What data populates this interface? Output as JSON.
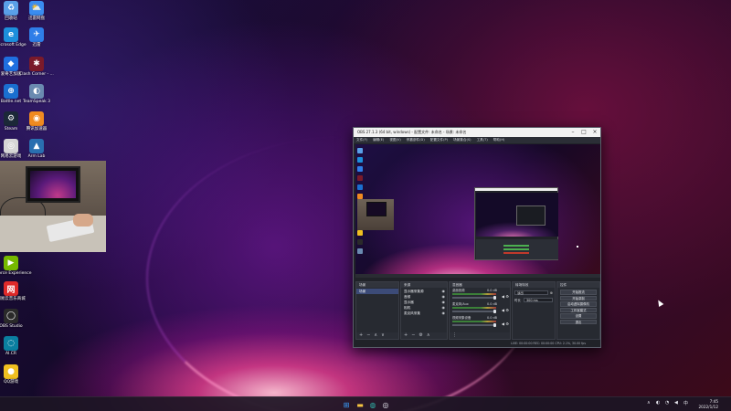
{
  "desktop": {
    "icons": [
      {
        "label": "回收站",
        "color": "#5aa0e8",
        "glyph": "♻",
        "name": "recycle-bin-icon"
      },
      {
        "label": "迅雷网盘",
        "color": "#3a8cf0",
        "glyph": "⛅",
        "name": "cloud-drive-icon"
      },
      {
        "label": "Microsoft Edge",
        "color": "#1d8fdc",
        "glyph": "e",
        "name": "edge-icon"
      },
      {
        "label": "迅雷",
        "color": "#2f7ee8",
        "glyph": "✈",
        "name": "thunder-icon"
      },
      {
        "label": "爱奇艺加速",
        "color": "#1f6fe0",
        "glyph": "◆",
        "name": "accelerator-icon"
      },
      {
        "label": "Clash Corner - ...",
        "color": "#7a1a2a",
        "glyph": "✱",
        "name": "clash-icon"
      },
      {
        "label": "Battle.net",
        "color": "#1a6fd0",
        "glyph": "⊕",
        "name": "battlenet-icon"
      },
      {
        "label": "TeamSpeak 3",
        "color": "#6a8ab0",
        "glyph": "◐",
        "name": "teamspeak-icon"
      },
      {
        "label": "Steam",
        "color": "#1b2838",
        "glyph": "⚙",
        "name": "steam-icon"
      },
      {
        "label": "腾讯加速器",
        "color": "#f08a20",
        "glyph": "◉",
        "name": "tencent-accelerator-icon"
      },
      {
        "label": "网易云游戏",
        "color": "#d6d6d6",
        "glyph": "◎",
        "name": "netease-cloud-game-icon"
      },
      {
        "label": "Arm Lab",
        "color": "#2a6fb0",
        "glyph": "▲",
        "name": "armlab-icon"
      },
      {
        "label": "GeForce Experience",
        "color": "#76b900",
        "glyph": "▶",
        "name": "geforce-icon"
      },
      {
        "label": "网易云音乐商城",
        "color": "#e02a2a",
        "glyph": "网",
        "name": "netease-music-icon"
      },
      {
        "label": "OBS Studio",
        "color": "#2a2a2a",
        "glyph": "◯",
        "name": "obs-studio-icon"
      },
      {
        "label": "AI.CR",
        "color": "#0b7fa0",
        "glyph": "◌",
        "name": "aicr-icon"
      },
      {
        "label": "QQ游戏",
        "color": "#f0c020",
        "glyph": "●",
        "name": "qq-game-icon"
      }
    ]
  },
  "obs": {
    "title": "OBS 27.1.3 (64 bit, windows) - 配置文件: 未命名 - 场景: 未命名",
    "menu": [
      "文件(F)",
      "编辑(E)",
      "视图(V)",
      "停靠部件(D)",
      "配置文件(P)",
      "场景集合(S)",
      "工具(T)",
      "帮助(H)"
    ],
    "docks": {
      "scenes": {
        "header": "场景",
        "items": [
          "场景"
        ]
      },
      "sources": {
        "header": "来源",
        "items": [
          "显示器采集源",
          "音频",
          "显示器",
          "相机",
          "麦克风采集"
        ]
      },
      "mixer": {
        "header": "混音器",
        "items": [
          {
            "name": "桌面音频",
            "value": "0.0 dB"
          },
          {
            "name": "麦克风/Aux",
            "value": "0.0 dB"
          },
          {
            "name": "视频采集设备",
            "value": "0.0 dB"
          },
          {
            "name": "媒体源",
            "value": "0.0 dB"
          }
        ]
      },
      "transitions": {
        "header": "转场特效",
        "type": "淡出",
        "duration_label": "时长",
        "duration": "300 ms"
      },
      "controls": {
        "header": "控件",
        "buttons": [
          "开始推流",
          "开始录制",
          "启动虚拟摄像机",
          "工作室模式",
          "设置",
          "退出"
        ]
      }
    },
    "status": "LIVE: 00:00:00   REC: 00:00:00   CPU: 2.1%, 30.00 fps"
  },
  "taskbar": {
    "time": "7:45",
    "date": "2022/1/12"
  }
}
